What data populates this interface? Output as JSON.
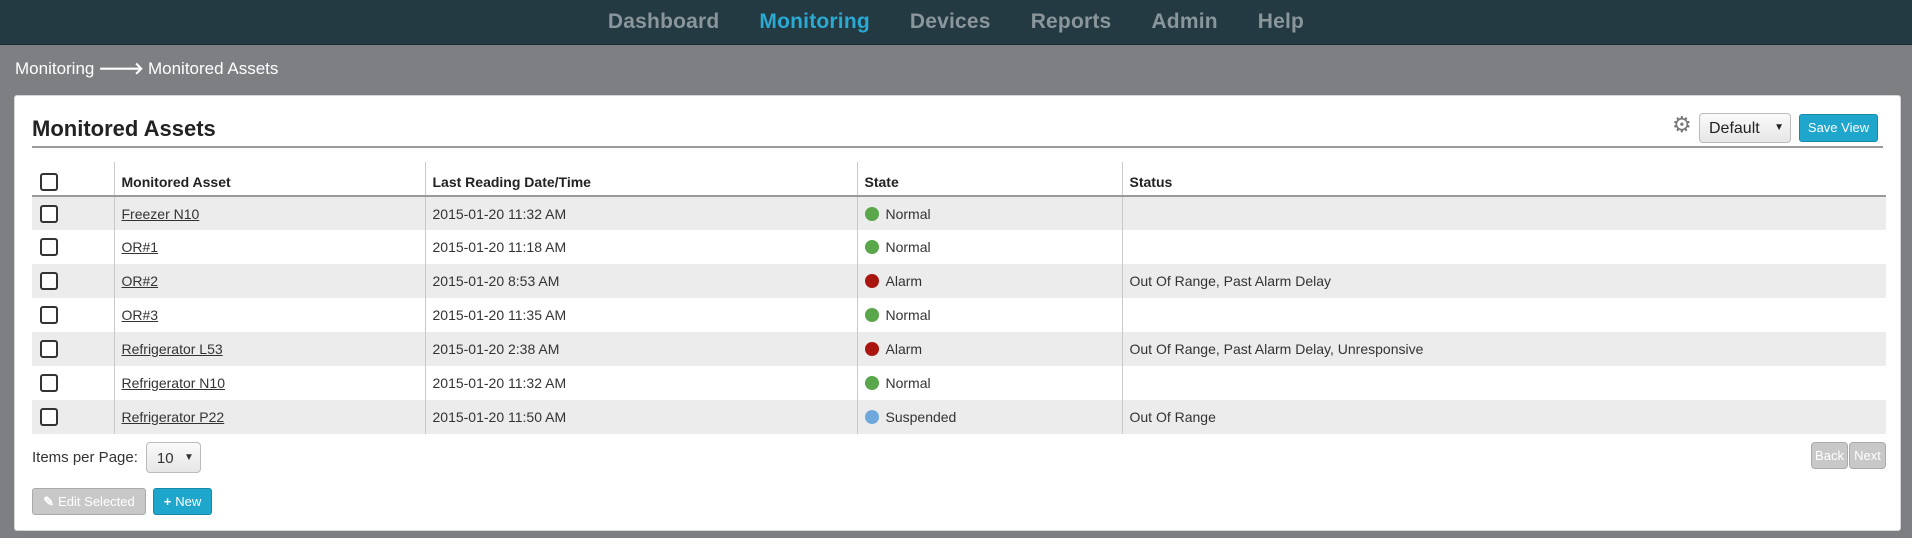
{
  "nav": {
    "items": [
      {
        "label": "Dashboard",
        "active": false
      },
      {
        "label": "Monitoring",
        "active": true
      },
      {
        "label": "Devices",
        "active": false
      },
      {
        "label": "Reports",
        "active": false
      },
      {
        "label": "Admin",
        "active": false
      },
      {
        "label": "Help",
        "active": false
      }
    ]
  },
  "breadcrumb": {
    "parent": "Monitoring",
    "separator": "🡒",
    "current": "Monitored Assets"
  },
  "panel": {
    "title": "Monitored Assets",
    "view_select": "Default",
    "save_view_label": "Save View"
  },
  "table": {
    "columns": [
      "Monitored Asset",
      "Last Reading Date/Time",
      "State",
      "Status"
    ],
    "rows": [
      {
        "asset": "Freezer N10",
        "date": "2015-01-20 11:32 AM",
        "state": "Normal",
        "state_color": "#5aa64a",
        "status": ""
      },
      {
        "asset": "OR#1",
        "date": "2015-01-20 11:18 AM",
        "state": "Normal",
        "state_color": "#5aa64a",
        "status": ""
      },
      {
        "asset": "OR#2",
        "date": "2015-01-20 8:53 AM",
        "state": "Alarm",
        "state_color": "#a8160f",
        "status": "Out Of Range, Past Alarm Delay"
      },
      {
        "asset": "OR#3",
        "date": "2015-01-20 11:35 AM",
        "state": "Normal",
        "state_color": "#5aa64a",
        "status": ""
      },
      {
        "asset": "Refrigerator L53",
        "date": "2015-01-20 2:38 AM",
        "state": "Alarm",
        "state_color": "#a8160f",
        "status": "Out Of Range, Past Alarm Delay, Unresponsive"
      },
      {
        "asset": "Refrigerator N10",
        "date": "2015-01-20 11:32 AM",
        "state": "Normal",
        "state_color": "#5aa64a",
        "status": ""
      },
      {
        "asset": "Refrigerator P22",
        "date": "2015-01-20 11:50 AM",
        "state": "Suspended",
        "state_color": "#6fa8dc",
        "status": "Out Of Range"
      }
    ]
  },
  "footer": {
    "items_per_page_label": "Items per Page:",
    "items_per_page_value": "10",
    "back_label": "Back",
    "next_label": "Next",
    "edit_selected_label": "Edit Selected",
    "new_label": "New"
  },
  "icons": {
    "settings": "gear-icon",
    "edit": "edit-icon",
    "add": "plus-icon",
    "caret": "caret-down-icon"
  }
}
